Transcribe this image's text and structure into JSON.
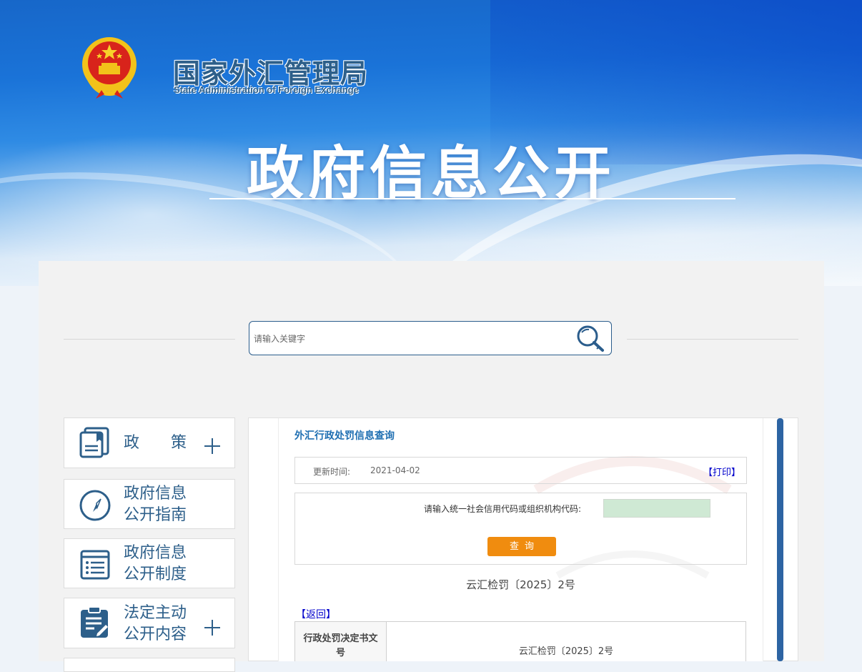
{
  "header": {
    "org_name_cn": "国家外汇管理局",
    "org_name_en": "State Administration of Foreign Exchange",
    "emblem_icon": "national-emblem-icon",
    "page_title": "政府信息公开"
  },
  "search": {
    "placeholder": "请输入关键字",
    "icon": "search-icon"
  },
  "sidebar": {
    "items": [
      {
        "label_line1": "政　　策",
        "label_line2": "",
        "icon": "book-icon",
        "expandable": true
      },
      {
        "label_line1": "政府信息",
        "label_line2": "公开指南",
        "icon": "compass-icon",
        "expandable": false
      },
      {
        "label_line1": "政府信息",
        "label_line2": "公开制度",
        "icon": "document-list-icon",
        "expandable": false
      },
      {
        "label_line1": "法定主动",
        "label_line2": "公开内容",
        "icon": "clipboard-edit-icon",
        "expandable": true
      }
    ]
  },
  "content": {
    "title": "外汇行政处罚信息查询",
    "update_label": "更新时间:",
    "update_date": "2021-04-02",
    "print_label": "【打印】",
    "query_label": "请输入统一社会信用代码或组织机构代码:",
    "query_button": "查询",
    "document_number": "云汇检罚〔2025〕2号",
    "back_label": "【返回】",
    "table": {
      "rows": [
        {
          "header": "行政处罚决定书文号",
          "value": "云汇检罚〔2025〕2号"
        }
      ]
    }
  },
  "colors": {
    "brand_blue": "#2d5f8a",
    "link_blue": "#1f6fb2",
    "button_orange": "#f08c0f",
    "scrollbar": "#2d64a3"
  }
}
